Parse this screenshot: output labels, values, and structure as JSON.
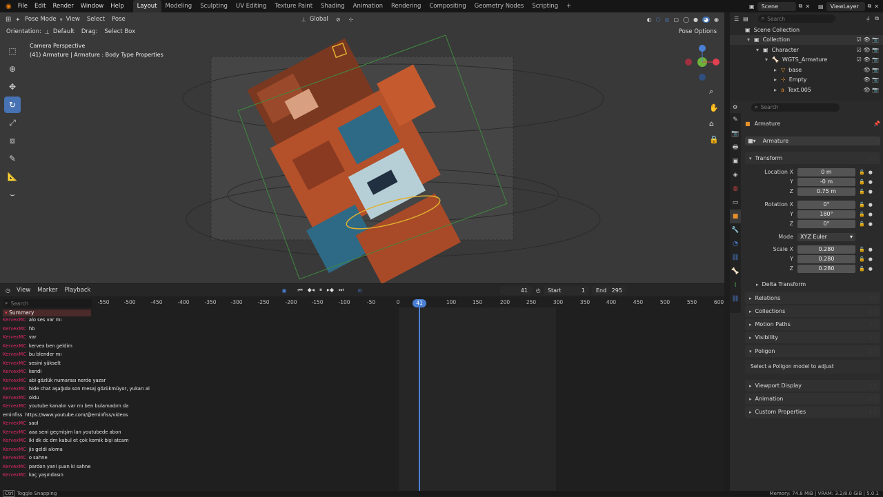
{
  "menu": {
    "items": [
      "File",
      "Edit",
      "Render",
      "Window",
      "Help"
    ]
  },
  "workspaces": {
    "tabs": [
      "Layout",
      "Modeling",
      "Sculpting",
      "UV Editing",
      "Texture Paint",
      "Shading",
      "Animation",
      "Rendering",
      "Compositing",
      "Geometry Nodes",
      "Scripting"
    ],
    "active": "Layout",
    "add": "+"
  },
  "scene": {
    "name": "Scene",
    "view_layer": "ViewLayer"
  },
  "viewport": {
    "mode": "Pose Mode",
    "menus": [
      "View",
      "Select",
      "Pose"
    ],
    "transform_orientation": "Global",
    "orientation_label": "Orientation:",
    "orientation_value": "Default",
    "drag_label": "Drag:",
    "drag_value": "Select Box",
    "pose_options": "Pose Options",
    "overlay_title": "Camera Perspective",
    "overlay_subtitle": "(41) Armature | Armature : Body Type Properties"
  },
  "timeline": {
    "editor_menus": [
      "View",
      "Marker",
      "Playback"
    ],
    "current_frame": "41",
    "start_label": "Start",
    "start": "1",
    "end_label": "End",
    "end": "295",
    "search_placeholder": "Search",
    "summary": "Summary",
    "ruler_ticks": [
      "-550",
      "-500",
      "-450",
      "-400",
      "-350",
      "-300",
      "-250",
      "-200",
      "-150",
      "-100",
      "-50",
      "0",
      "100",
      "150",
      "200",
      "250",
      "300",
      "350",
      "400",
      "450",
      "500",
      "550",
      "600"
    ],
    "playhead_label": "41"
  },
  "chat": [
    {
      "user": "KervexMC",
      "msg": "alo ses var mı"
    },
    {
      "user": "KervexMC",
      "msg": "hb"
    },
    {
      "user": "KervexMC",
      "msg": "var"
    },
    {
      "user": "KervexMC",
      "msg": "kervex ben geldim"
    },
    {
      "user": "KervexMC",
      "msg": "bu blender mı"
    },
    {
      "user": "KervexMC",
      "msg": "sesini yükselt"
    },
    {
      "user": "KervexMC",
      "msg": "kendi"
    },
    {
      "user": "KervexMC",
      "msg": "abi gözlük numarası nerde yazar"
    },
    {
      "user": "KervexMC",
      "msg": "bide chat aşağıda son mesaj gözükmüyor, yukarı al"
    },
    {
      "user": "KervexMC",
      "msg": "oldu"
    },
    {
      "user": "KervexMC",
      "msg": "youtube kanalın var mı ben bulamadım da"
    },
    {
      "user": "eminfiss",
      "msg": "https://www.youtube.com/@eminfiss/videos"
    },
    {
      "user": "KervexMC",
      "msg": "saol"
    },
    {
      "user": "KervexMC",
      "msg": "aaa seni geçmişim lan youtubede abon"
    },
    {
      "user": "KervexMC",
      "msg": "iki dk dc dm kabul et çok komik bişi atcam"
    },
    {
      "user": "KervexMC",
      "msg": "jis geldi akıma"
    },
    {
      "user": "KervexMC",
      "msg": "o sahne"
    },
    {
      "user": "KervexMC",
      "msg": "pardon yani şuan ki sahne"
    },
    {
      "user": "KervexMC",
      "msg": "kaç yaşındasın"
    }
  ],
  "outliner": {
    "search_placeholder": "Search",
    "rows": [
      {
        "label": "Scene Collection",
        "indent": 0
      },
      {
        "label": "Collection",
        "indent": 1
      },
      {
        "label": "Character",
        "indent": 2
      },
      {
        "label": "WGTS_Armature",
        "indent": 3
      },
      {
        "label": "base",
        "indent": 4
      },
      {
        "label": "Empty",
        "indent": 4
      },
      {
        "label": "Text.005",
        "indent": 4
      }
    ]
  },
  "properties": {
    "search_placeholder": "Search",
    "object_name": "Armature",
    "data_name": "Armature",
    "transform_header": "Transform",
    "location": {
      "label": "Location X",
      "x": "0 m",
      "y_label": "Y",
      "y": "-0 m",
      "z_label": "Z",
      "z": "0.75 m"
    },
    "rotation": {
      "label": "Rotation X",
      "x": "0°",
      "y_label": "Y",
      "y": "180°",
      "z_label": "Z",
      "z": "0°"
    },
    "mode_label": "Mode",
    "mode_value": "XYZ Euler",
    "scale": {
      "label": "Scale X",
      "x": "0.280",
      "y_label": "Y",
      "y": "0.280",
      "z_label": "Z",
      "z": "0.280"
    },
    "delta_transform": "Delta Transform",
    "panels": [
      "Relations",
      "Collections",
      "Motion Paths",
      "Visibility",
      "Poligon"
    ],
    "poligon_hint": "Select a Poligon model to adjust",
    "panels_after": [
      "Viewport Display",
      "Animation",
      "Custom Properties"
    ]
  },
  "status": {
    "left": "Toggle Snapping",
    "left_key": "Ctrl",
    "right": "Memory: 74.8 MiB | VRAM: 3.2/8.0 GiB | 5.0.1"
  },
  "colors": {
    "accent": "#4772b3",
    "chat_user": "#e0286a",
    "playhead": "#4a7fd4"
  }
}
